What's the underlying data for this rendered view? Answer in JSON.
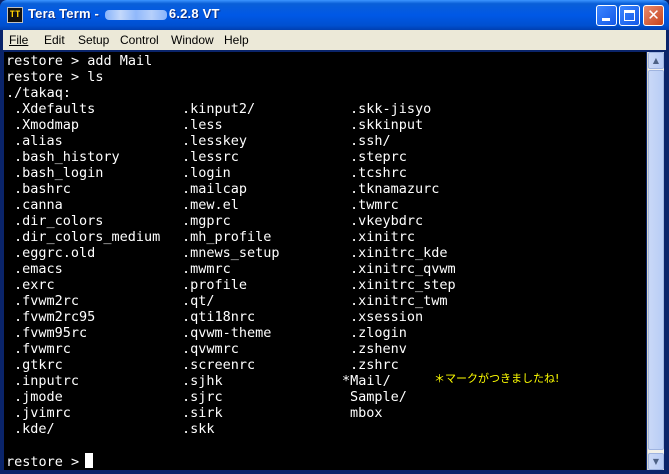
{
  "window": {
    "title_prefix": "Tera Term - ",
    "title_suffix": "6.2.8 VT"
  },
  "menu": [
    "File",
    "Edit",
    "Setup",
    "Control",
    "Window",
    "Help"
  ],
  "terminal": {
    "lines": [
      "restore > add Mail",
      "restore > ls",
      "./takaq:"
    ],
    "columns": [
      [
        ".Xdefaults",
        ".Xmodmap",
        ".alias",
        ".bash_history",
        ".bash_login",
        ".bashrc",
        ".canna",
        ".dir_colors",
        ".dir_colors_medium",
        ".eggrc.old",
        ".emacs",
        ".exrc",
        ".fvwm2rc",
        ".fvwm2rc95",
        ".fvwm95rc",
        ".fvwmrc",
        ".gtkrc",
        ".inputrc",
        ".jmode",
        ".jvimrc",
        ".kde/"
      ],
      [
        ".kinput2/",
        ".less",
        ".lesskey",
        ".lessrc",
        ".login",
        ".mailcap",
        ".mew.el",
        ".mgprc",
        ".mh_profile",
        ".mnews_setup",
        ".mwmrc",
        ".profile",
        ".qt/",
        ".qti18nrc",
        ".qvwm-theme",
        ".qvwmrc",
        ".screenrc",
        ".sjhk",
        ".sjrc",
        ".sirk",
        ".skk"
      ],
      [
        ".skk-jisyo",
        ".skkinput",
        ".ssh/",
        ".steprc",
        ".tcshrc",
        ".tknamazurc",
        ".twmrc",
        ".vkeybdrc",
        ".xinitrc",
        ".xinitrc_kde",
        ".xinitrc_qvwm",
        ".xinitrc_step",
        ".xinitrc_twm",
        ".xsession",
        ".zlogin",
        ".zshenv",
        ".zshrc",
        "*Mail/",
        "Sample/",
        "mbox"
      ]
    ],
    "prompt": "restore >",
    "annotation": "＊マークがつきましたね!"
  }
}
